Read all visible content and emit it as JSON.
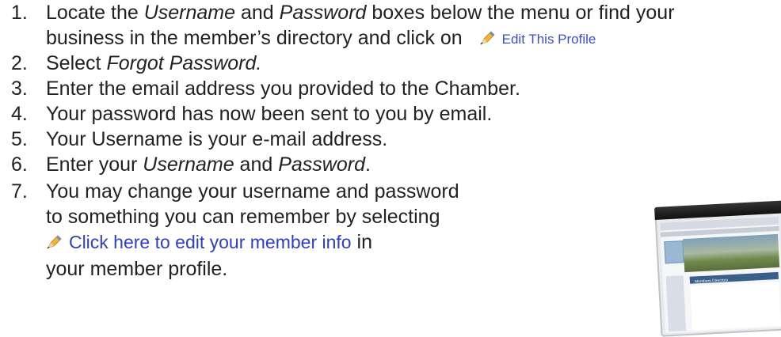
{
  "instructions": [
    {
      "num": "1.",
      "parts": [
        "Locate the ",
        "Username",
        " and ",
        "Password",
        " boxes below the menu or find your"
      ],
      "line2": "business in the member’s directory and click on",
      "link": "Edit This Profile"
    },
    {
      "num": "2.",
      "pre": "Select ",
      "em": "Forgot Password."
    },
    {
      "num": "3.",
      "text": "Enter the email address you provided to the Chamber."
    },
    {
      "num": "4.",
      "text": "Your password has now been sent to you by email."
    },
    {
      "num": "5.",
      "text": "Your Username is your e-mail address."
    },
    {
      "num": "6.",
      "pre": "Enter your ",
      "em1": "Username",
      "mid": " and ",
      "em2": "Password",
      "post": "."
    },
    {
      "num": "7.",
      "line1": "You may change your username and password",
      "line2": "to something you can remember by selecting",
      "link": "Click here to edit your member info",
      "after": " in",
      "line4": "your member profile."
    }
  ],
  "screenshot": {
    "heading": "Members Directory"
  },
  "icons": {
    "pencil": "pencil-icon"
  },
  "colors": {
    "link": "#3b4fc6",
    "text": "#222222"
  }
}
